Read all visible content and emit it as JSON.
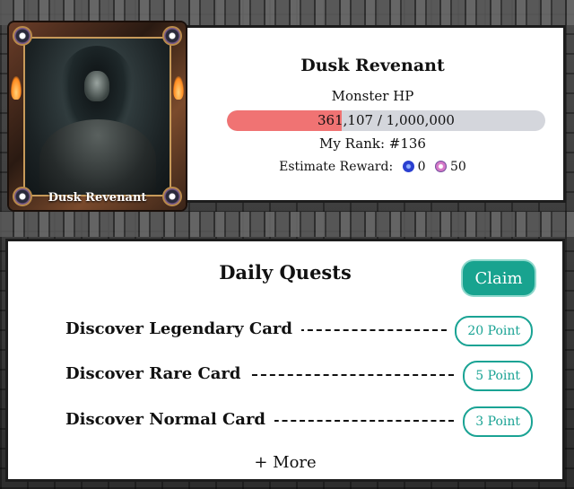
{
  "boss": {
    "card_name": "Dusk Revenant",
    "title": "Dusk Revenant",
    "hp_label": "Monster HP",
    "hp_text": "361,107 / 1,000,000",
    "hp_fraction": 0.361,
    "rank_text": "My Rank: #136",
    "reward_label": "Estimate Reward:",
    "reward_coin": "0",
    "reward_potion": "50"
  },
  "quests": {
    "title": "Daily Quests",
    "claim_label": "Claim",
    "items": [
      {
        "name": "Discover Legendary Card",
        "points": "20 Point"
      },
      {
        "name": "Discover Rare Card",
        "points": "5 Point"
      },
      {
        "name": "Discover Normal Card",
        "points": "3 Point"
      }
    ],
    "more_label": "+ More"
  },
  "colors": {
    "hp_fill": "#f07373",
    "hp_track": "#d4d6dc",
    "accent": "#18a38f"
  }
}
